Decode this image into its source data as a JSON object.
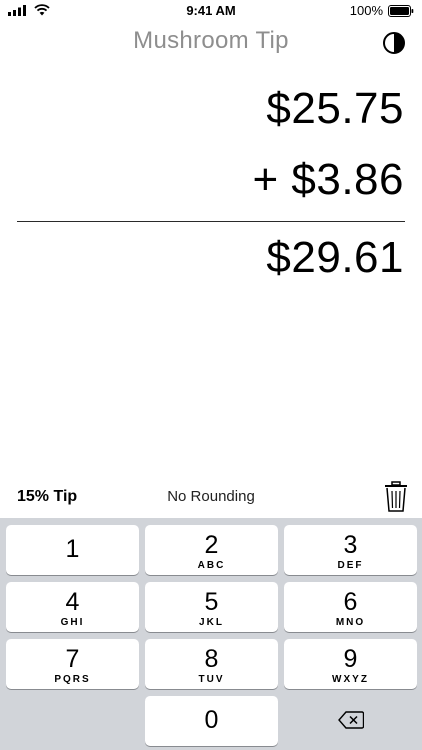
{
  "status": {
    "time": "9:41 AM",
    "battery": "100%"
  },
  "header": {
    "title": "Mushroom Tip"
  },
  "amounts": {
    "bill": "$25.75",
    "tip": "+ $3.86",
    "total": "$29.61"
  },
  "options": {
    "tip_percent": "15% Tip",
    "rounding": "No Rounding"
  },
  "keypad": {
    "keys": [
      {
        "digit": "1",
        "letters": ""
      },
      {
        "digit": "2",
        "letters": "ABC"
      },
      {
        "digit": "3",
        "letters": "DEF"
      },
      {
        "digit": "4",
        "letters": "GHI"
      },
      {
        "digit": "5",
        "letters": "JKL"
      },
      {
        "digit": "6",
        "letters": "MNO"
      },
      {
        "digit": "7",
        "letters": "PQRS"
      },
      {
        "digit": "8",
        "letters": "TUV"
      },
      {
        "digit": "9",
        "letters": "WXYZ"
      },
      {
        "digit": "0",
        "letters": ""
      }
    ]
  },
  "icons": {
    "signal": "cellular-signal-icon",
    "wifi": "wifi-icon",
    "battery": "battery-icon",
    "theme": "contrast-icon",
    "trash": "trash-icon",
    "delete": "backspace-icon"
  }
}
